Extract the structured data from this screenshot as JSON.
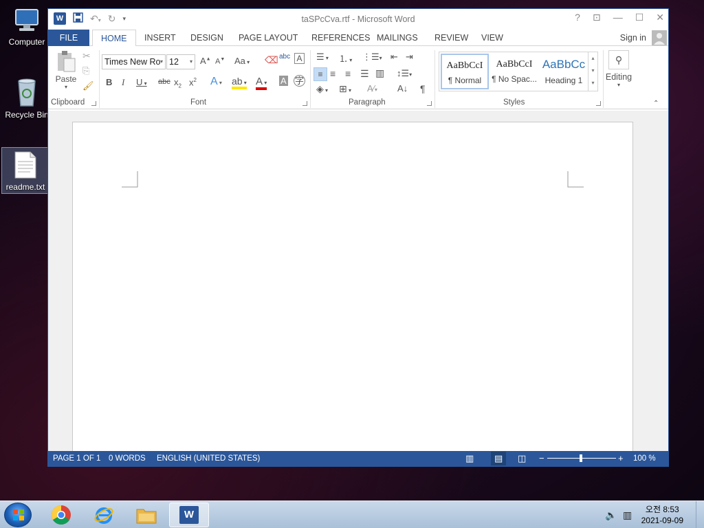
{
  "desktop": {
    "icons": [
      {
        "label": "Computer"
      },
      {
        "label": "Recycle Bin"
      },
      {
        "label": "readme.txt"
      }
    ]
  },
  "window": {
    "title": "taSPcCva.rtf - Microsoft Word",
    "help": "?",
    "tabs": [
      "FILE",
      "HOME",
      "INSERT",
      "DESIGN",
      "PAGE LAYOUT",
      "REFERENCES",
      "MAILINGS",
      "REVIEW",
      "VIEW"
    ],
    "active_tab": "HOME",
    "signin": "Sign in"
  },
  "ribbon": {
    "clipboard": {
      "paste": "Paste",
      "label": "Clipboard"
    },
    "font": {
      "name": "Times New Ro",
      "size": "12",
      "label": "Font",
      "case": "Aa"
    },
    "paragraph": {
      "label": "Paragraph"
    },
    "styles": {
      "items": [
        {
          "sample": "AaBbCcI",
          "name": "¶ Normal"
        },
        {
          "sample": "AaBbCcI",
          "name": "¶ No Spac..."
        },
        {
          "sample": "AaBbCc",
          "name": "Heading 1"
        }
      ],
      "label": "Styles"
    },
    "editing": {
      "label": "Editing"
    }
  },
  "statusbar": {
    "page": "PAGE 1 OF 1",
    "words": "0 WORDS",
    "language": "ENGLISH (UNITED STATES)",
    "zoom_minus": "−",
    "zoom_plus": "+",
    "zoom": "100 %"
  },
  "taskbar": {
    "time": "오전 8:53",
    "date": "2021-09-09"
  },
  "colors": {
    "accent": "#2b579a"
  }
}
